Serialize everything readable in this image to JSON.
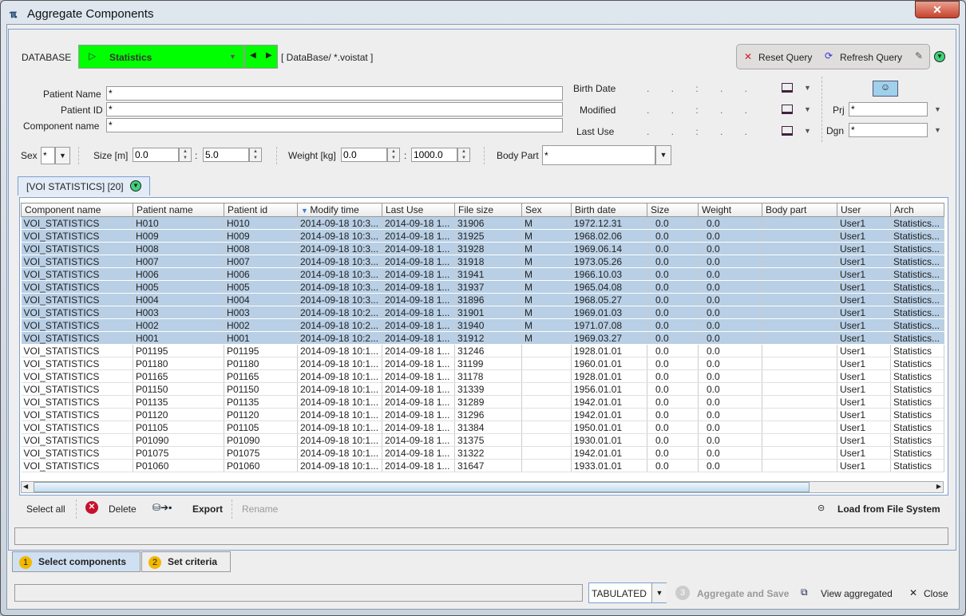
{
  "window": {
    "title": "Aggregate Components",
    "close": "✕"
  },
  "database": {
    "label": "DATABASE",
    "selected": "Statistics",
    "path": "[ DataBase/ *.voistat ]"
  },
  "query": {
    "reset": "Reset Query",
    "refresh": "Refresh Query"
  },
  "fields": {
    "patient_name_label": "Patient Name",
    "patient_name": "*",
    "patient_id_label": "Patient ID",
    "patient_id": "*",
    "component_label": "Component name",
    "component": "*",
    "birth_label": "Birth Date",
    "modified_label": "Modified",
    "lastuse_label": "Last Use",
    "date_placeholder": ".   .   :   .   .",
    "prj_label": "Prj",
    "prj": "*",
    "dgn_label": "Dgn",
    "dgn": "*",
    "sex_label": "Sex",
    "sex": "*",
    "size_label": "Size [m]",
    "size_min": "0.0",
    "size_max": "5.0",
    "weight_label": "Weight [kg]",
    "weight_min": "0.0",
    "weight_max": "1000.0",
    "bodypart_label": "Body Part",
    "bodypart": "*",
    "colon": ":"
  },
  "tab": {
    "label": "[VOI STATISTICS] [20]"
  },
  "table": {
    "columns": [
      "Component name",
      "Patient name",
      "Patient id",
      "Modify time",
      "Last Use",
      "File size",
      "Sex",
      "Birth date",
      "Size",
      "Weight",
      "Body part",
      "User",
      "Arch"
    ],
    "rows": [
      [
        "VOI_STATISTICS",
        "H010",
        "H010",
        "2014-09-18 10:3...",
        "2014-09-18 1...",
        "31906",
        "M",
        "1972.12.31",
        "0.0",
        "0.0",
        "",
        "User1",
        "Statistics..."
      ],
      [
        "VOI_STATISTICS",
        "H009",
        "H009",
        "2014-09-18 10:3...",
        "2014-09-18 1...",
        "31925",
        "M",
        "1968.02.06",
        "0.0",
        "0.0",
        "",
        "User1",
        "Statistics..."
      ],
      [
        "VOI_STATISTICS",
        "H008",
        "H008",
        "2014-09-18 10:3...",
        "2014-09-18 1...",
        "31928",
        "M",
        "1969.06.14",
        "0.0",
        "0.0",
        "",
        "User1",
        "Statistics..."
      ],
      [
        "VOI_STATISTICS",
        "H007",
        "H007",
        "2014-09-18 10:3...",
        "2014-09-18 1...",
        "31918",
        "M",
        "1973.05.26",
        "0.0",
        "0.0",
        "",
        "User1",
        "Statistics..."
      ],
      [
        "VOI_STATISTICS",
        "H006",
        "H006",
        "2014-09-18 10:3...",
        "2014-09-18 1...",
        "31941",
        "M",
        "1966.10.03",
        "0.0",
        "0.0",
        "",
        "User1",
        "Statistics..."
      ],
      [
        "VOI_STATISTICS",
        "H005",
        "H005",
        "2014-09-18 10:3...",
        "2014-09-18 1...",
        "31937",
        "M",
        "1965.04.08",
        "0.0",
        "0.0",
        "",
        "User1",
        "Statistics..."
      ],
      [
        "VOI_STATISTICS",
        "H004",
        "H004",
        "2014-09-18 10:3...",
        "2014-09-18 1...",
        "31896",
        "M",
        "1968.05.27",
        "0.0",
        "0.0",
        "",
        "User1",
        "Statistics..."
      ],
      [
        "VOI_STATISTICS",
        "H003",
        "H003",
        "2014-09-18 10:2...",
        "2014-09-18 1...",
        "31901",
        "M",
        "1969.01.03",
        "0.0",
        "0.0",
        "",
        "User1",
        "Statistics..."
      ],
      [
        "VOI_STATISTICS",
        "H002",
        "H002",
        "2014-09-18 10:2...",
        "2014-09-18 1...",
        "31940",
        "M",
        "1971.07.08",
        "0.0",
        "0.0",
        "",
        "User1",
        "Statistics..."
      ],
      [
        "VOI_STATISTICS",
        "H001",
        "H001",
        "2014-09-18 10:2...",
        "2014-09-18 1...",
        "31912",
        "M",
        "1969.03.27",
        "0.0",
        "0.0",
        "",
        "User1",
        "Statistics..."
      ],
      [
        "VOI_STATISTICS",
        "P01195",
        "P01195",
        "2014-09-18 10:1...",
        "2014-09-18 1...",
        "31246",
        "",
        "1928.01.01",
        "0.0",
        "0.0",
        "",
        "User1",
        "Statistics"
      ],
      [
        "VOI_STATISTICS",
        "P01180",
        "P01180",
        "2014-09-18 10:1...",
        "2014-09-18 1...",
        "31199",
        "",
        "1960.01.01",
        "0.0",
        "0.0",
        "",
        "User1",
        "Statistics"
      ],
      [
        "VOI_STATISTICS",
        "P01165",
        "P01165",
        "2014-09-18 10:1...",
        "2014-09-18 1...",
        "31178",
        "",
        "1928.01.01",
        "0.0",
        "0.0",
        "",
        "User1",
        "Statistics"
      ],
      [
        "VOI_STATISTICS",
        "P01150",
        "P01150",
        "2014-09-18 10:1...",
        "2014-09-18 1...",
        "31339",
        "",
        "1956.01.01",
        "0.0",
        "0.0",
        "",
        "User1",
        "Statistics"
      ],
      [
        "VOI_STATISTICS",
        "P01135",
        "P01135",
        "2014-09-18 10:1...",
        "2014-09-18 1...",
        "31289",
        "",
        "1942.01.01",
        "0.0",
        "0.0",
        "",
        "User1",
        "Statistics"
      ],
      [
        "VOI_STATISTICS",
        "P01120",
        "P01120",
        "2014-09-18 10:1...",
        "2014-09-18 1...",
        "31296",
        "",
        "1942.01.01",
        "0.0",
        "0.0",
        "",
        "User1",
        "Statistics"
      ],
      [
        "VOI_STATISTICS",
        "P01105",
        "P01105",
        "2014-09-18 10:1...",
        "2014-09-18 1...",
        "31384",
        "",
        "1950.01.01",
        "0.0",
        "0.0",
        "",
        "User1",
        "Statistics"
      ],
      [
        "VOI_STATISTICS",
        "P01090",
        "P01090",
        "2014-09-18 10:1...",
        "2014-09-18 1...",
        "31375",
        "",
        "1930.01.01",
        "0.0",
        "0.0",
        "",
        "User1",
        "Statistics"
      ],
      [
        "VOI_STATISTICS",
        "P01075",
        "P01075",
        "2014-09-18 10:1...",
        "2014-09-18 1...",
        "31322",
        "",
        "1942.01.01",
        "0.0",
        "0.0",
        "",
        "User1",
        "Statistics"
      ],
      [
        "VOI_STATISTICS",
        "P01060",
        "P01060",
        "2014-09-18 10:1...",
        "2014-09-18 1...",
        "31647",
        "",
        "1933.01.01",
        "0.0",
        "0.0",
        "",
        "User1",
        "Statistics"
      ]
    ],
    "selected_count": 10,
    "sort_column": "Modify time",
    "selection_color": "#b8cfe5"
  },
  "actions": {
    "select_all": "Select all",
    "delete": "Delete",
    "export": "Export",
    "rename": "Rename",
    "load": "Load from File System"
  },
  "steps": [
    {
      "num": "1",
      "label": "Select components"
    },
    {
      "num": "2",
      "label": "Set criteria"
    }
  ],
  "footer": {
    "format": "TABULATED",
    "step3": "3",
    "aggregate": "Aggregate and Save",
    "view": "View aggregated",
    "close": "Close"
  },
  "colors": {
    "database_bg": "#00ff00",
    "step_badge": "#f2b800"
  }
}
